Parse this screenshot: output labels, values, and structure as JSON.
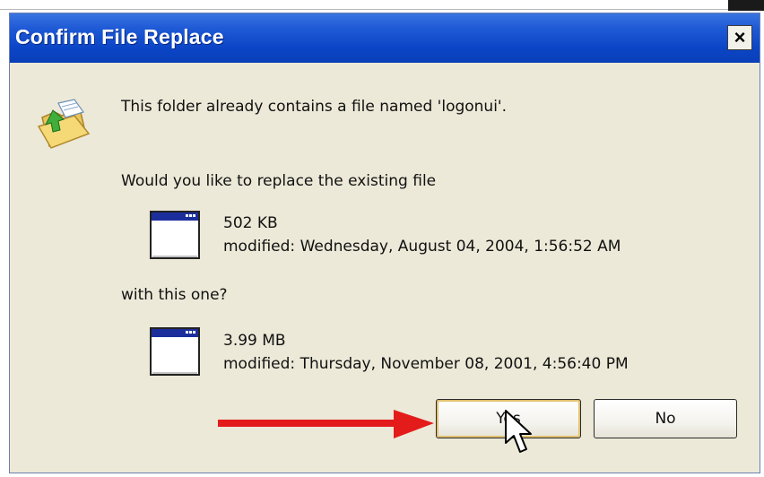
{
  "dialog": {
    "title": "Confirm File Replace",
    "close_glyph": "×",
    "message_line1": "This folder already contains a file named 'logonui'.",
    "message_line2": "Would you like to replace the existing file",
    "existing_file": {
      "size": "502 KB",
      "modified": "modified: Wednesday, August 04, 2004, 1:56:52 AM"
    },
    "with_text": "with this one?",
    "new_file": {
      "size": "3.99 MB",
      "modified": "modified: Thursday, November 08, 2001, 4:56:40 PM"
    },
    "buttons": {
      "yes": "Yes",
      "no": "No"
    }
  },
  "icons": {
    "dialog_icon": "folder-replace-icon",
    "file_icon": "application-window-icon",
    "annotation_arrow": "red-arrow-icon",
    "cursor": "mouse-pointer-icon"
  },
  "colors": {
    "titlebar": "#0b45c6",
    "dialog_background": "#ece9d8",
    "arrow": "#e41b1b"
  }
}
